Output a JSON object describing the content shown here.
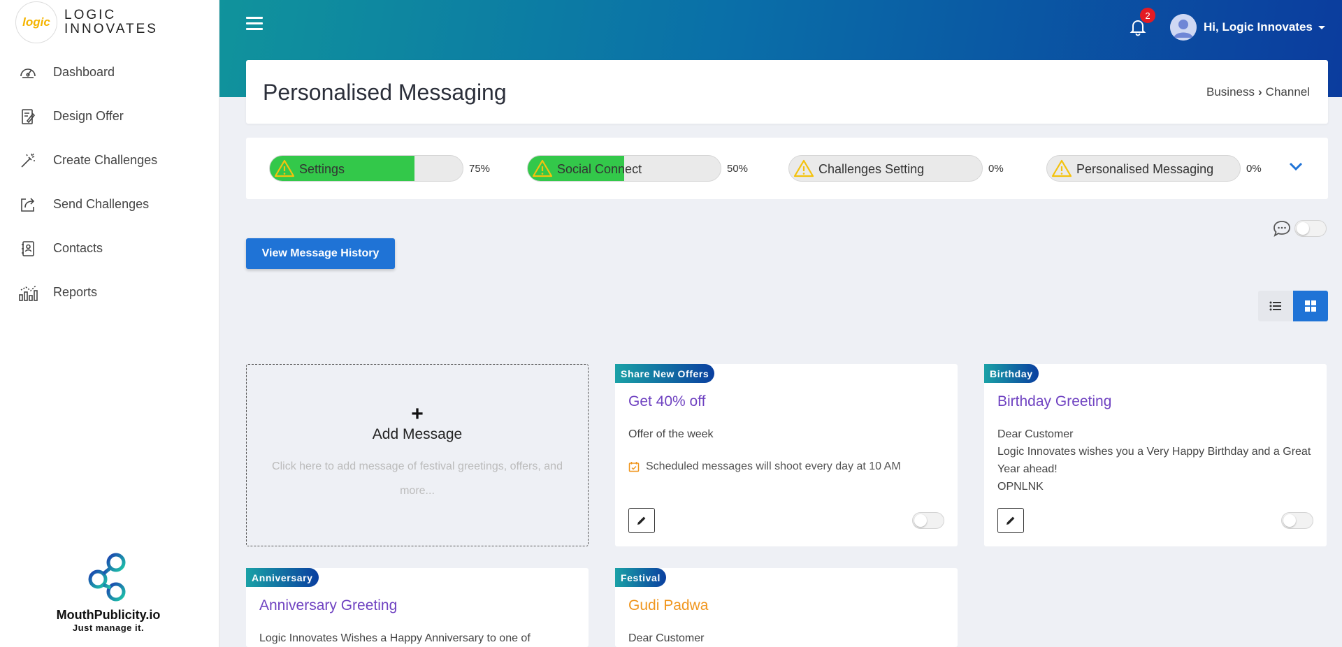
{
  "brand": {
    "logo_text": "logic",
    "name_line1": "LOGIC",
    "name_line2": "INNOVATES"
  },
  "sidebar": {
    "items": [
      {
        "label": "Dashboard",
        "icon": "speedometer-icon"
      },
      {
        "label": "Design Offer",
        "icon": "design-offer-icon"
      },
      {
        "label": "Create Challenges",
        "icon": "wand-icon"
      },
      {
        "label": "Send Challenges",
        "icon": "share-icon"
      },
      {
        "label": "Contacts",
        "icon": "contact-book-icon"
      },
      {
        "label": "Reports",
        "icon": "bar-chart-icon"
      }
    ],
    "footer": {
      "name": "MouthPublicity.io",
      "tagline": "Just manage it."
    }
  },
  "header": {
    "notification_count": "2",
    "user_greeting": "Hi, Logic Innovates"
  },
  "page": {
    "title": "Personalised Messaging",
    "breadcrumb": {
      "parent": "Business",
      "current": "Channel"
    }
  },
  "progress": [
    {
      "label": "Settings",
      "percent_text": "75%",
      "fill": 0.75
    },
    {
      "label": "Social Connect",
      "percent_text": "50%",
      "fill": 0.5
    },
    {
      "label": "Challenges Setting",
      "percent_text": "0%",
      "fill": 0
    },
    {
      "label": "Personalised Messaging",
      "percent_text": "0%",
      "fill": 0
    }
  ],
  "actions": {
    "view_history": "View Message History"
  },
  "add_card": {
    "plus": "+",
    "title": "Add Message",
    "description": "Click here to add message of festival greetings, offers, and more..."
  },
  "cards": [
    {
      "tag": "Share New Offers",
      "title": "Get 40% off",
      "title_color": "#6f42c1",
      "body": [
        "Offer of the week"
      ],
      "schedule": "Scheduled messages will shoot every day at 10 AM",
      "enabled": false
    },
    {
      "tag": "Birthday",
      "title": "Birthday Greeting",
      "title_color": "#6f42c1",
      "body": [
        "Dear Customer",
        "Logic Innovates wishes you a Very Happy Birthday and a Great Year ahead!",
        "OPNLNK"
      ],
      "enabled": false
    },
    {
      "tag": "Anniversary",
      "title": "Anniversary Greeting",
      "title_color": "#6f42c1",
      "body": [
        "Logic Innovates Wishes a Happy Anniversary to one of"
      ]
    },
    {
      "tag": "Festival",
      "title": "Gudi Padwa",
      "title_color": "#f0961e",
      "body": [
        "Dear Customer"
      ]
    }
  ],
  "colors": {
    "primary": "#1f73d6",
    "progress_fill": "#33c84a",
    "badge": "#e41b23",
    "warning": "#f4c20d"
  }
}
